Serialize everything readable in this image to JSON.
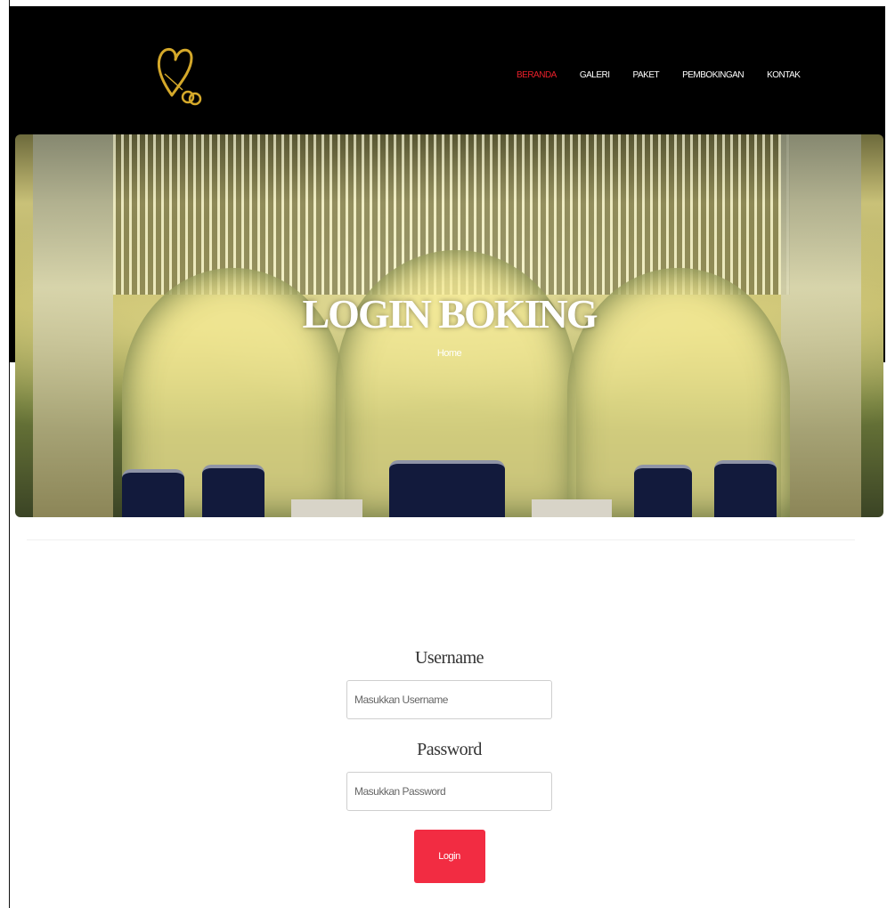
{
  "nav": {
    "items": [
      "BERANDA",
      "GALERI",
      "PAKET",
      "PEMBOKINGAN",
      "KONTAK"
    ],
    "active": "BERANDA"
  },
  "hero": {
    "title": "LOGIN BOKING",
    "breadcrumb": "Home"
  },
  "form": {
    "username_label": "Username",
    "username_placeholder": "Masukkan Username",
    "password_label": "Password",
    "password_placeholder": "Masukkan Password",
    "login_label": "Login"
  },
  "colors": {
    "header_bg": "#000000",
    "nav_active": "#e8202a",
    "logo_gold": "#d4a82a",
    "button_bg": "#f22c42"
  },
  "icons": {
    "logo": "heart-rings-icon"
  }
}
